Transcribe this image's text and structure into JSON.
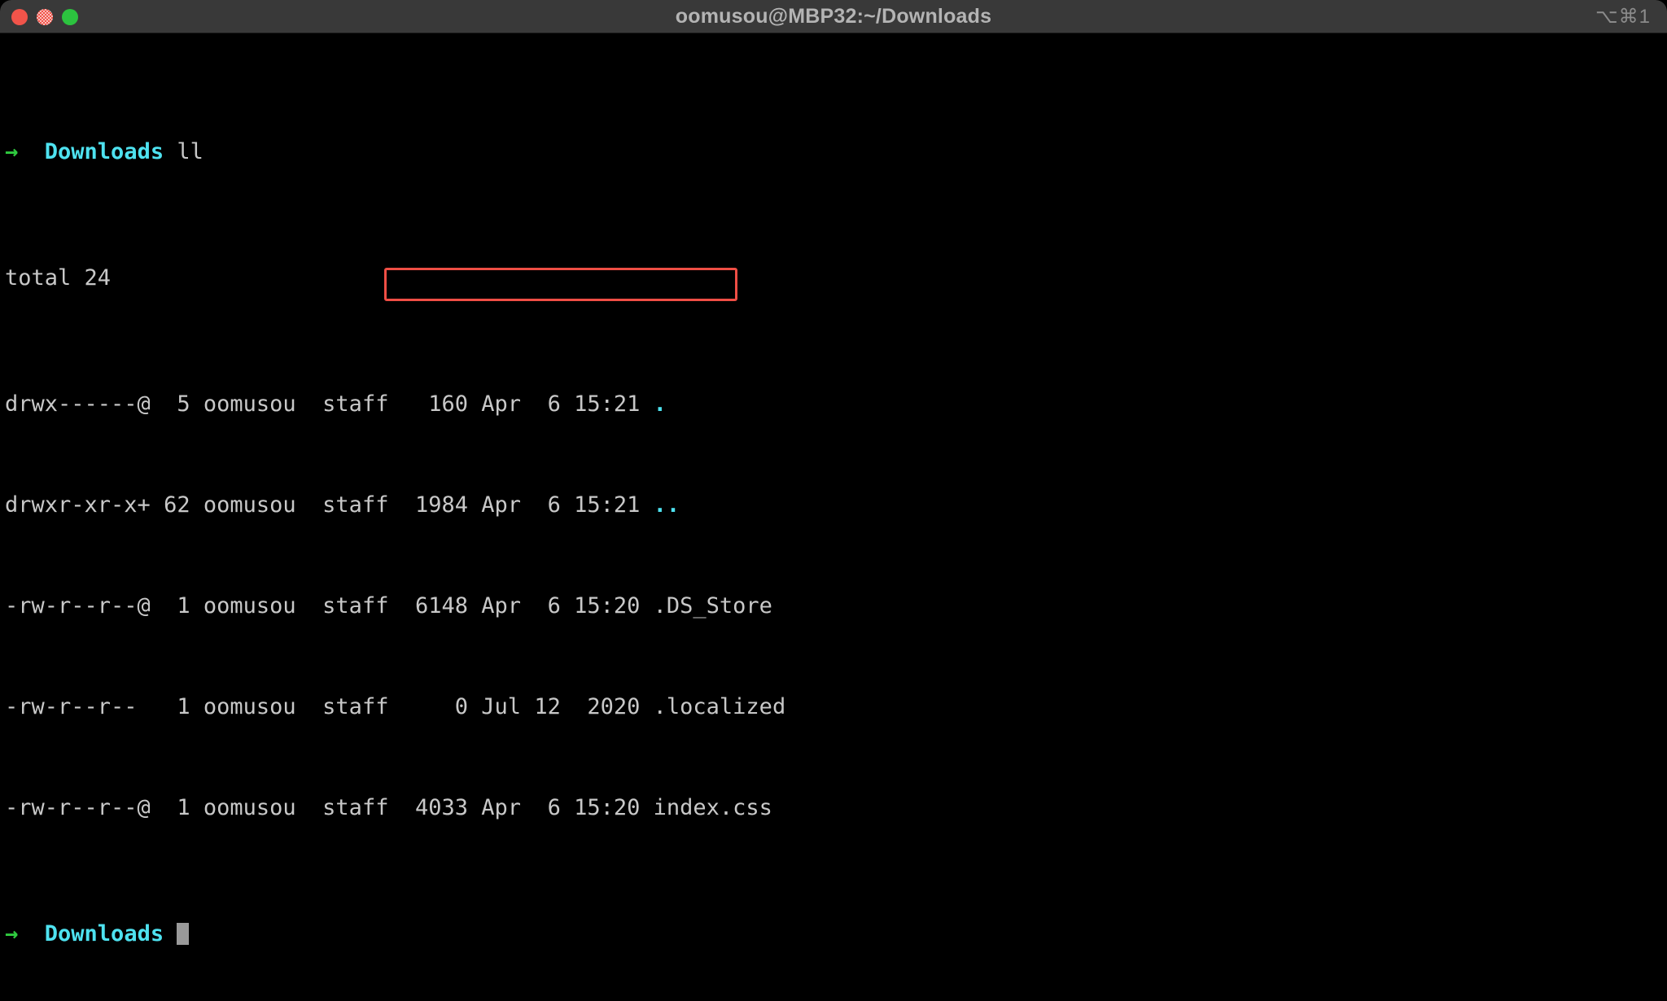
{
  "window": {
    "title": "oomusou@MBP32:~/Downloads",
    "shortcut_hint": "⌥⌘1",
    "traffic_lights": [
      {
        "name": "close",
        "color": "#f1544a"
      },
      {
        "name": "minimize",
        "color": "#f1544a"
      },
      {
        "name": "maximize",
        "color": "#2cc33f"
      }
    ]
  },
  "terminal": {
    "colors": {
      "background": "#000000",
      "foreground": "#c8c8c8",
      "prompt_arrow": "#2fcb3f",
      "prompt_cwd": "#4ee2f0",
      "directory": "#4ee2f0",
      "highlight": "#ef4e45"
    },
    "prompt": {
      "arrow": "→",
      "cwd": "Downloads"
    },
    "command": "ll",
    "total_line": "total 24",
    "listing": [
      {
        "perms": "drwx------@",
        "links": " 5",
        "owner": "oomusou",
        "group": "staff",
        "size": " 160",
        "month": "Apr",
        "day": " 6",
        "time": "15:21",
        "name": ".",
        "type": "directory"
      },
      {
        "perms": "drwxr-xr-x+",
        "links": "62",
        "owner": "oomusou",
        "group": "staff",
        "size": "1984",
        "month": "Apr",
        "day": " 6",
        "time": "15:21",
        "name": "..",
        "type": "directory"
      },
      {
        "perms": "-rw-r--r--@",
        "links": " 1",
        "owner": "oomusou",
        "group": "staff",
        "size": "6148",
        "month": "Apr",
        "day": " 6",
        "time": "15:20",
        "name": ".DS_Store",
        "type": "file"
      },
      {
        "perms": "-rw-r--r-- ",
        "links": " 1",
        "owner": "oomusou",
        "group": "staff",
        "size": "   0",
        "month": "Jul",
        "day": "12",
        "time": " 2020",
        "name": ".localized",
        "type": "file"
      },
      {
        "perms": "-rw-r--r--@",
        "links": " 1",
        "owner": "oomusou",
        "group": "staff",
        "size": "4033",
        "month": "Apr",
        "day": " 6",
        "time": "15:20",
        "name": "index.css",
        "type": "file"
      }
    ],
    "final_prompt": {
      "arrow": "→",
      "cwd": "Downloads",
      "input": ""
    },
    "annotation": {
      "label": "highlighted-region",
      "text": "4033 Apr  6 15:20 index.css",
      "color": "#ef4e45"
    }
  }
}
